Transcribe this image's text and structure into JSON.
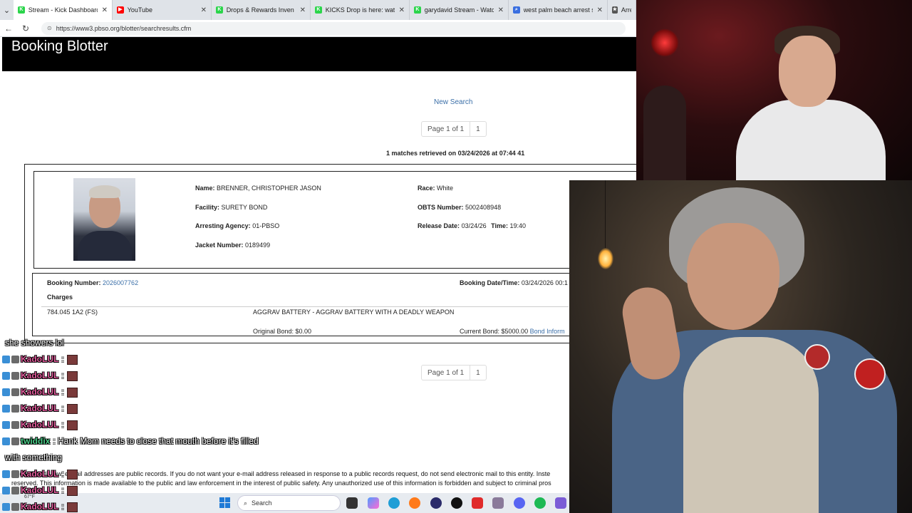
{
  "browser": {
    "tabs": [
      {
        "title": "Stream - Kick Dashboard",
        "active": true,
        "color": "#2bd54b",
        "glyph": "K"
      },
      {
        "title": "YouTube",
        "active": false,
        "color": "#ff0000",
        "glyph": "▶"
      },
      {
        "title": "Drops & Rewards Inven",
        "active": false,
        "color": "#2bd54b",
        "glyph": "K"
      },
      {
        "title": "KICKS Drop is here: watch, e",
        "active": false,
        "color": "#2bd54b",
        "glyph": "K"
      },
      {
        "title": "garydavid Stream - Watch L",
        "active": false,
        "color": "#2bd54b",
        "glyph": "K"
      },
      {
        "title": "west palm beach arrest sear",
        "active": false,
        "color": "#3a6fe0",
        "glyph": "⌕"
      },
      {
        "title": "Arre",
        "active": false,
        "color": "#555555",
        "glyph": "★"
      }
    ],
    "url": "https://www3.pbso.org/blotter/searchresults.cfm"
  },
  "page": {
    "title": "Booking Blotter",
    "new_search": "New Search",
    "pager_top": {
      "label": "Page 1 of 1",
      "page": "1"
    },
    "pager_bottom": {
      "label": "Page 1 of 1",
      "page": "1"
    },
    "matches_count": "1",
    "matches_text": "matches retrieved on",
    "matches_date": "03/24/2026",
    "matches_at": "at",
    "matches_time": "07:44 41"
  },
  "record": {
    "name_label": "Name:",
    "name": "BRENNER, CHRISTOPHER JASON",
    "facility_label": "Facility:",
    "facility": "SURETY BOND",
    "agency_label": "Arresting Agency:",
    "agency": "01-PBSO",
    "jacket_label": "Jacket Number:",
    "jacket": "0189499",
    "race_label": "Race:",
    "race": "White",
    "obts_label": "OBTS Number:",
    "obts": "5002408948",
    "release_label": "Release Date:",
    "release_date": "03/24/26",
    "time_label": "Time:",
    "release_time": "19:40"
  },
  "booking": {
    "number_label": "Booking Number:",
    "number": "2026007762",
    "datetime_label": "Booking Date/Time:",
    "datetime": "03/24/2026 00:1",
    "charges_label": "Charges",
    "charge_code": "784.045 1A2 (FS)",
    "charge_desc": "AGGRAV BATTERY - AGGRAV BATTERY WITH A DEADLY WEAPON",
    "original_bond": "Original Bond: $0.00",
    "current_bond": "Current Bond: $5000.00",
    "bond_info": "Bond Inform"
  },
  "disclaimer": {
    "line1": "Under Florida law, e-mail addresses are public records. If you do not want your e-mail address released in response to a public records request, do not send electronic mail to this entity. Inste",
    "line2": "reserved. This information is made available to the public and law enforcement in the interest of public safety. Any unauthorized use of this information is forbidden and subject to criminal pros"
  },
  "chat": {
    "messages": [
      {
        "user": "",
        "text": "she showers lol"
      },
      {
        "user": "KadoLUL",
        "text": ":"
      },
      {
        "user": "KadoLUL",
        "text": ":"
      },
      {
        "user": "KadoLUL",
        "text": ":"
      },
      {
        "user": "KadoLUL",
        "text": ":"
      },
      {
        "user": "KadoLUL",
        "text": ":"
      },
      {
        "user": "twiddix",
        "text": ": Hank Mom needs to close that mouth before it's filled"
      },
      {
        "user": "",
        "text": "with something"
      },
      {
        "user": "KadoLUL",
        "text": ":"
      },
      {
        "user": "KadoLUL",
        "text": ":"
      },
      {
        "user": "KadoLUL",
        "text": ":"
      }
    ]
  },
  "taskbar": {
    "weather": "67°F",
    "search_label": "Search"
  }
}
